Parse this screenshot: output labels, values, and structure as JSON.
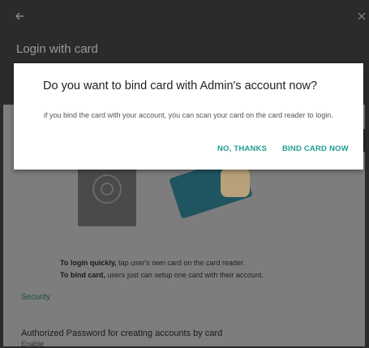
{
  "app": {
    "title": "Login with card"
  },
  "icons": {
    "back": "arrow-left-icon",
    "close": "close-icon"
  },
  "dialog": {
    "title": "Do you want to bind card with Admin's account now?",
    "message": "if you bind the card with your account, you can scan your card on the card reader to login.",
    "no_label": "NO, THANKS",
    "yes_label": "BIND CARD NOW"
  },
  "instructions": {
    "line1_bold": "To login quickly,",
    "line1_rest": " tap user's own card on the card reader.",
    "line2_bold": "To bind card,",
    "line2_rest": " users just can setup one card with their account."
  },
  "security": {
    "section_label": "Security",
    "auth_title": "Authorized Password for creating accounts by card",
    "auth_value": "Enable"
  },
  "colors": {
    "accent": "#1f9e91",
    "section": "#1c4e44"
  }
}
